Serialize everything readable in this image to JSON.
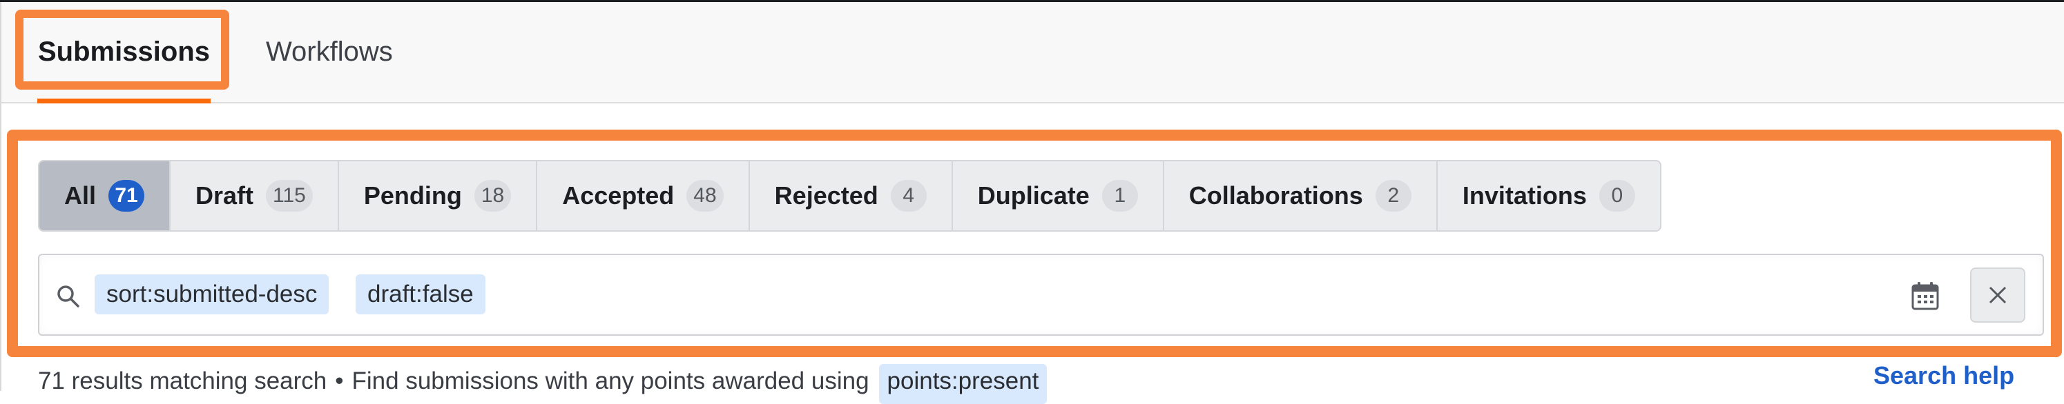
{
  "nav": {
    "tabs": [
      {
        "label": "Submissions",
        "active": true
      },
      {
        "label": "Workflows",
        "active": false
      }
    ]
  },
  "filters": {
    "tabs": [
      {
        "label": "All",
        "count": "71",
        "active": true
      },
      {
        "label": "Draft",
        "count": "115",
        "active": false
      },
      {
        "label": "Pending",
        "count": "18",
        "active": false
      },
      {
        "label": "Accepted",
        "count": "48",
        "active": false
      },
      {
        "label": "Rejected",
        "count": "4",
        "active": false
      },
      {
        "label": "Duplicate",
        "count": "1",
        "active": false
      },
      {
        "label": "Collaborations",
        "count": "2",
        "active": false
      },
      {
        "label": "Invitations",
        "count": "0",
        "active": false
      }
    ]
  },
  "search": {
    "icon": "search-icon",
    "tokens": [
      "sort:submitted-desc",
      "draft:false"
    ],
    "date_icon": "calendar-icon",
    "clear_icon": "close-icon"
  },
  "results": {
    "summary": "71 results matching search",
    "separator": "•",
    "tip": "Find submissions with any points awarded using",
    "tip_token": "points:present",
    "help_link": "Search help"
  },
  "colors": {
    "accent": "#fa6a0a",
    "highlight": "#f6843c",
    "badge_active": "#1f5fc9",
    "link": "#1f5fc9",
    "chip_bg": "#d8e8fd"
  }
}
